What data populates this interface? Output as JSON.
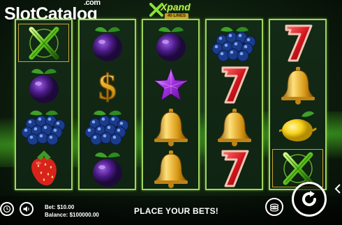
{
  "watermark": {
    "text": "SlotCatalog",
    "suffix": ".com"
  },
  "game_logo": {
    "name": "Xpand",
    "badge": "40 LINES"
  },
  "reels": [
    [
      "xpand-wild",
      "plum",
      "blueberries",
      "strawberry"
    ],
    [
      "plum",
      "dollar",
      "blueberries",
      "plum"
    ],
    [
      "plum",
      "star",
      "bell",
      "bell"
    ],
    [
      "blueberries",
      "seven",
      "bell",
      "seven"
    ],
    [
      "seven",
      "bell",
      "lemon",
      "xpand-wild"
    ]
  ],
  "footer": {
    "bet_label": "Bet:",
    "bet_value": "$10.00",
    "balance_label": "Balance:",
    "balance_value": "$100000.00",
    "status": "PLACE YOUR BETS!"
  },
  "colors": {
    "reel_border": "#9fd85a",
    "glow": "#5ae628"
  },
  "icons": [
    "history-icon",
    "sound-icon",
    "coins-icon",
    "spin-icon",
    "chevron-left-icon"
  ]
}
